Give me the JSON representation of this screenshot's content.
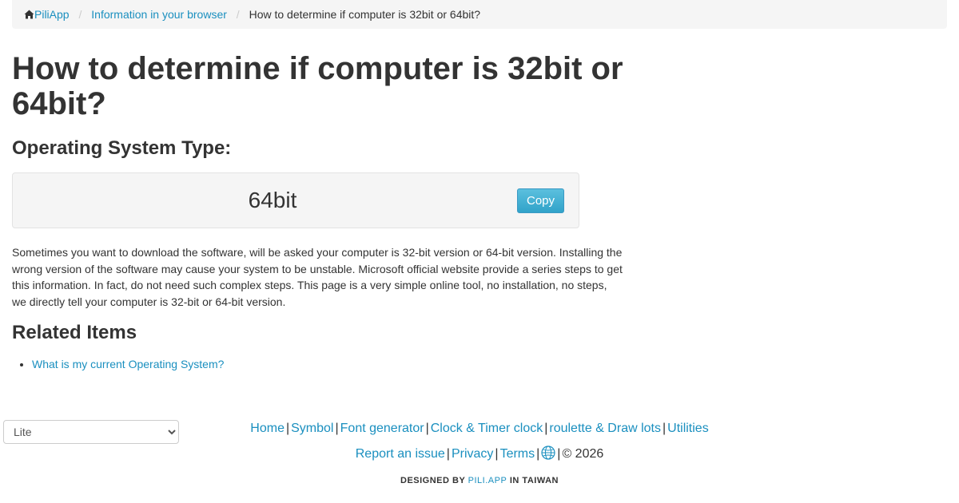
{
  "breadcrumb": {
    "home_label": "PiliApp",
    "section_label": "Information in your browser",
    "current_label": "How to determine if computer is 32bit or 64bit?"
  },
  "main": {
    "title": "How to determine if computer is 32bit or 64bit?",
    "section_title": "Operating System Type:",
    "result_value": "64bit",
    "copy_label": "Copy",
    "description": "Sometimes you want to download the software, will be asked your computer is 32-bit version or 64-bit version. Installing the wrong version of the software may cause your system to be unstable. Microsoft official website provide a series steps to get this information. In fact, do not need such complex steps. This page is a very simple online tool, no installation, no steps, we directly tell your computer is 32-bit or 64-bit version.",
    "related_title": "Related Items",
    "related_items": [
      {
        "label": "What is my current Operating System?"
      }
    ]
  },
  "footer": {
    "theme_select": {
      "selected": "Lite"
    },
    "links_row1": [
      "Home",
      "Symbol",
      "Font generator",
      "Clock & Timer clock",
      "roulette & Draw lots",
      "Utilities"
    ],
    "links_row2": [
      "Report an issue",
      "Privacy",
      "Terms"
    ],
    "copyright": "© 2026",
    "credit_prefix": "DESIGNED BY",
    "credit_brand": "PILI.APP",
    "credit_suffix": "IN TAIWAN"
  },
  "icons": {
    "home": "home-icon",
    "globe": "globe-icon"
  },
  "colors": {
    "link": "#1a8fbf",
    "button": "#4fb0d9",
    "panel": "#f5f5f5",
    "text": "#333333"
  }
}
